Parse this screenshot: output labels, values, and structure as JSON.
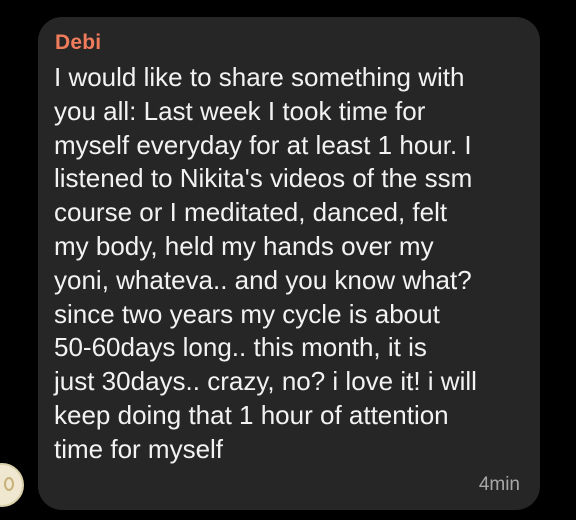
{
  "message": {
    "sender": "Debi",
    "lines": [
      "I would like to share something with",
      "you all: Last week I took time for",
      "myself everyday for at least 1 hour. I",
      "listened to Nikita's videos of the ssm",
      "course or I meditated, danced, felt",
      "my body, held my hands over my",
      "yoni, whateva.. and you know what?",
      "since two years my cycle is about",
      "50-60days long.. this month, it is",
      "just 30days.. crazy, no? i love it! i will",
      "keep doing that 1 hour of attention",
      "time for myself"
    ],
    "timestamp": "4min"
  },
  "avatar": {
    "icon": "user-avatar-icon"
  },
  "colors": {
    "background": "#000000",
    "bubble": "#262626",
    "sender_name": "#f07c5c",
    "message_text": "#f2f2f2",
    "timestamp": "#a8a8a8"
  }
}
